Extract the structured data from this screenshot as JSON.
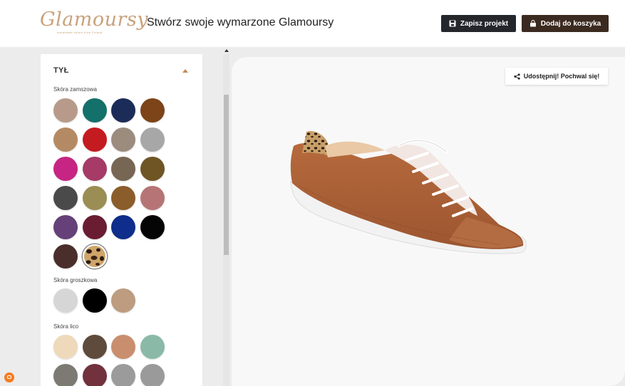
{
  "header": {
    "logo_text": "Glamoursy",
    "logo_tagline": "handmade shoes from Poland",
    "title": "Stwórz swoje wymarzone Glamoursy",
    "save_label": "Zapisz projekt",
    "cart_label": "Dodaj do koszyka"
  },
  "canvas": {
    "share_label": "Udostępnij! Pochwal się!"
  },
  "panel": {
    "section_title": "TYŁ",
    "groups": [
      {
        "label": "Skóra zamszowa",
        "swatches": [
          "#b89a8a",
          "#13706a",
          "#1c2c58",
          "#7c4418",
          "#b48a65",
          "#c41b20",
          "#9b8c7e",
          "#a7a7a7",
          "#c72583",
          "#a53b66",
          "#776654",
          "#6f5524",
          "#4a4a4a",
          "#9a8e55",
          "#8b5d2b",
          "#b77476",
          "#654079",
          "#6a1c33",
          "#0f2d8a",
          "#050505",
          "#4a2e2b",
          "leopard"
        ]
      },
      {
        "label": "Skóra groszkowa",
        "swatches": [
          "#d6d6d6",
          "#000000",
          "#bd9c80"
        ]
      },
      {
        "label": "Skóra lico",
        "swatches": [
          "#efd9bb",
          "#5f4b3c",
          "#c98e6e",
          "#8ab9a8",
          "#7c7a72",
          "#71313d",
          "#9b9b9b",
          "#9a9a9a"
        ]
      }
    ]
  }
}
